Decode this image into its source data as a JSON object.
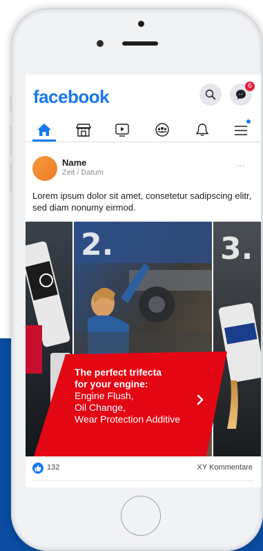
{
  "header": {
    "logo": "facebook",
    "messenger_badge": "6"
  },
  "nav": {
    "items": [
      "home-icon",
      "marketplace-icon",
      "watch-icon",
      "groups-icon",
      "notifications-icon",
      "menu-icon"
    ]
  },
  "post": {
    "name": "Name",
    "time": "Zeit / Datum",
    "more": "...",
    "text": "Lorem ipsum dolor sit amet, consetetur sadipscing elitr, sed diam nonumy eirmod.",
    "image": {
      "step2": "2.",
      "step3": "3.",
      "headline_1": "The perfect trifecta",
      "headline_2": "for your engine:",
      "line_1": "Engine Flush,",
      "line_2": "Oil Change,",
      "line_3": "Wear Protection Additive"
    },
    "likes": "132",
    "comments": "XY Kommentare"
  },
  "colors": {
    "brand": "#1877f2",
    "accent_red": "#e30613",
    "background_blue": "#0a4da2"
  }
}
